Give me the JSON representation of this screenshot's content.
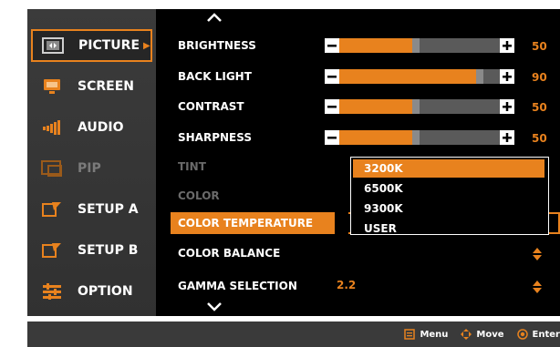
{
  "menu": {
    "items": [
      {
        "label": "PICTURE",
        "icon": "picture-icon",
        "state": "active"
      },
      {
        "label": "SCREEN",
        "icon": "screen-icon",
        "state": "normal"
      },
      {
        "label": "AUDIO",
        "icon": "audio-icon",
        "state": "normal"
      },
      {
        "label": "PIP",
        "icon": "pip-icon",
        "state": "disabled"
      },
      {
        "label": "SETUP A",
        "icon": "setup-a-icon",
        "state": "normal"
      },
      {
        "label": "SETUP B",
        "icon": "setup-b-icon",
        "state": "normal"
      },
      {
        "label": "OPTION",
        "icon": "option-icon",
        "state": "normal"
      }
    ],
    "active_arrow": "▶"
  },
  "picture": {
    "brightness": {
      "label": "BRIGHTNESS",
      "value": "50",
      "level": 0.5
    },
    "backlight": {
      "label": "BACK LIGHT",
      "value": "90",
      "level": 0.9
    },
    "contrast": {
      "label": "CONTRAST",
      "value": "50",
      "level": 0.5
    },
    "sharpness": {
      "label": "SHARPNESS",
      "value": "50",
      "level": 0.5
    },
    "tint": {
      "label": "TINT"
    },
    "color": {
      "label": "COLOR"
    },
    "color_temperature": {
      "label": "COLOR TEMPERATURE"
    },
    "color_balance": {
      "label": "COLOR BALANCE"
    },
    "gamma": {
      "label": "GAMMA SELECTION",
      "value": "2.2"
    }
  },
  "dropdown": {
    "options": [
      "3200K",
      "6500K",
      "9300K",
      "USER"
    ],
    "selected": "3200K"
  },
  "footer": {
    "menu": "Menu",
    "move": "Move",
    "enter": "Enter"
  },
  "colors": {
    "accent": "#e8821e",
    "panel": "#333333",
    "content_bg": "#000000"
  }
}
